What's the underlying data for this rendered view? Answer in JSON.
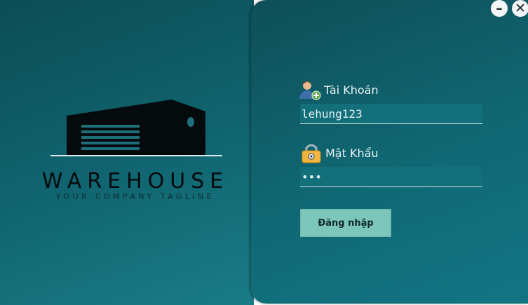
{
  "window": {
    "minimize_glyph": "–",
    "close_glyph": "✕"
  },
  "logo": {
    "wordmark": "WAREHOUSE",
    "tagline": "YOUR COMPANY TAGLINE"
  },
  "form": {
    "username_label": "Tài Khoản",
    "username_value": "lehung123",
    "password_label": "Mật Khẩu",
    "password_value": "•••",
    "login_label": "Đăng nhập"
  },
  "icons": {
    "username": "user-add-icon",
    "password": "padlock-icon"
  }
}
